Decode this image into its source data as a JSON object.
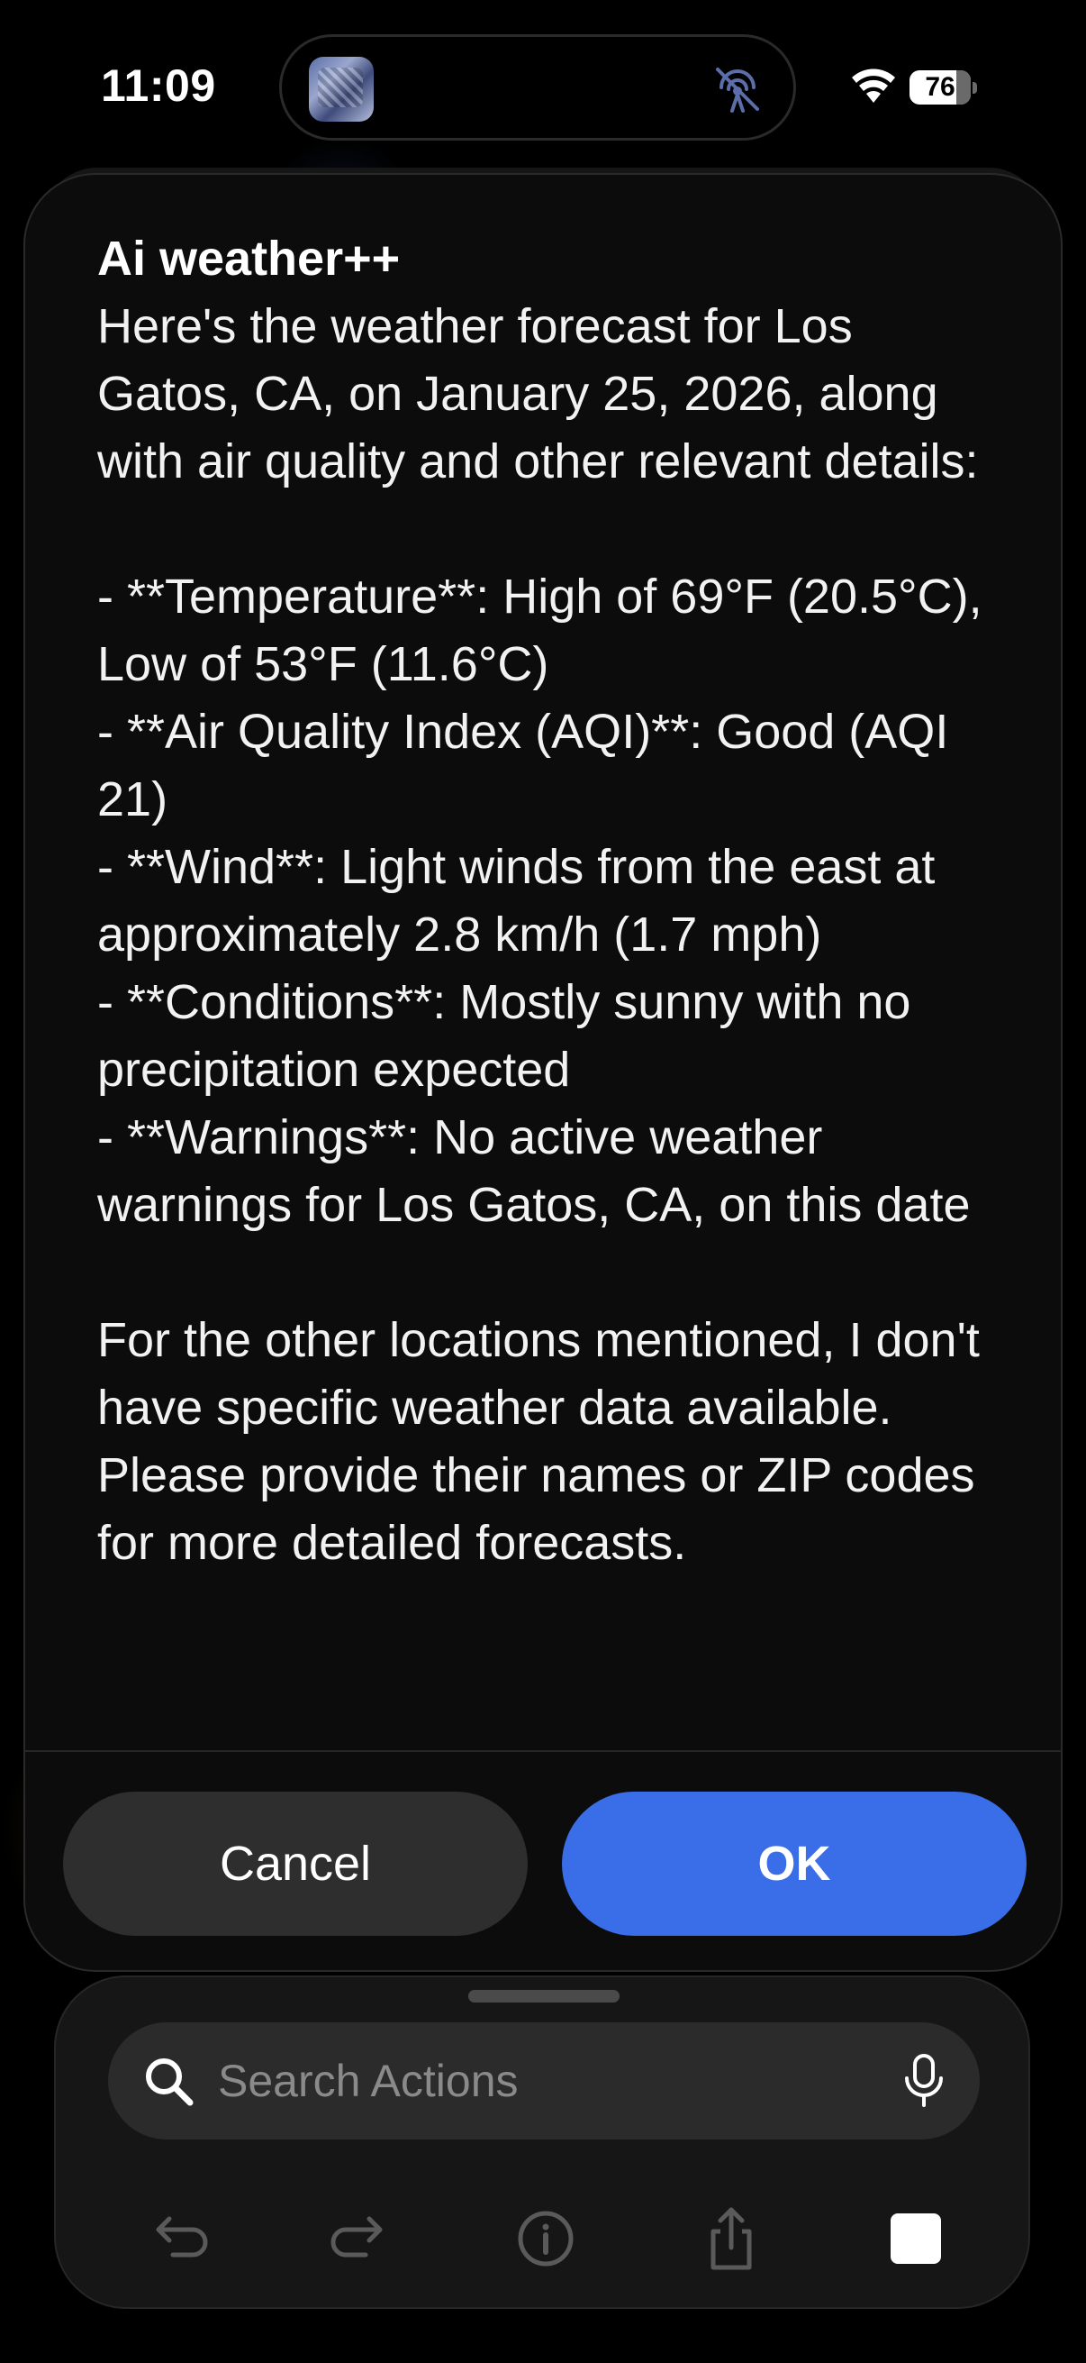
{
  "status_bar": {
    "time": "11:09",
    "battery": "76"
  },
  "dialog": {
    "title": "Ai weather++",
    "message": "Here's the weather forecast for Los Gatos, CA, on January 25, 2026, along with air quality and other relevant details:\n\n- **Temperature**: High of 69°F (20.5°C), Low of 53°F (11.6°C)\n- **Air Quality Index (AQI)**: Good (AQI 21)\n- **Wind**: Light winds from the east at approximately 2.8 km/h (1.7 mph)\n- **Conditions**: Mostly sunny with no precipitation expected\n- **Warnings**: No active weather warnings for Los Gatos, CA, on this date\n\nFor the other locations mentioned, I don't have specific weather data available. Please provide their names or ZIP codes for more detailed forecasts.",
    "cancel_label": "Cancel",
    "ok_label": "OK",
    "ok_color": "#3a6ee8"
  },
  "toolbar": {
    "search_placeholder": "Search Actions",
    "icons": [
      "search-icon",
      "mic-icon",
      "undo-icon",
      "redo-icon",
      "info-icon",
      "share-icon",
      "stop-icon"
    ]
  }
}
